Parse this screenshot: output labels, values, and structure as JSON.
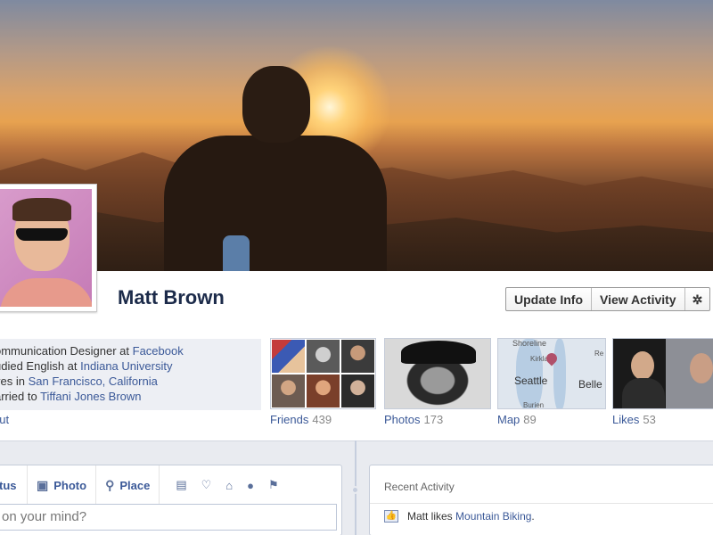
{
  "profile": {
    "name": "Matt Brown"
  },
  "actions": {
    "update_info": "Update Info",
    "view_activity": "View Activity",
    "settings_icon": "gear-icon",
    "settings_glyph": "✲"
  },
  "info": {
    "rows": [
      {
        "text": "ommunication Designer at ",
        "link": "Facebook"
      },
      {
        "text": "udied English at ",
        "link": "Indiana University"
      },
      {
        "text": "ves in ",
        "link": "San Francisco, California"
      },
      {
        "text": "arried to ",
        "link": "Tiffani Jones Brown"
      }
    ],
    "about": "out"
  },
  "thumbs": {
    "friends": {
      "label": "Friends",
      "count": "439"
    },
    "photos": {
      "label": "Photos",
      "count": "173"
    },
    "map": {
      "label": "Map",
      "count": "89",
      "places": [
        "Shoreline",
        "Kirkland",
        "Seattle",
        "Belle",
        "Re",
        "Burien"
      ]
    },
    "likes": {
      "label": "Likes",
      "count": "53"
    }
  },
  "composer": {
    "tabs": {
      "status": "tus",
      "photo": "Photo",
      "place": "Place"
    },
    "placeholder": "on your mind?",
    "extra_icons": [
      "briefcase-icon",
      "heart-icon",
      "home-icon",
      "apple-icon",
      "flag-icon"
    ]
  },
  "recent": {
    "title": "Recent Activity",
    "item_prefix": "Matt likes ",
    "item_link": "Mountain Biking",
    "item_suffix": "."
  }
}
